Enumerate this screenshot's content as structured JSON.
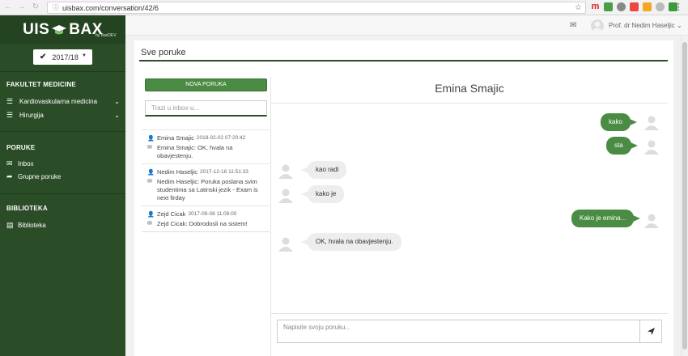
{
  "browser": {
    "url": "uisbax.com/conversation/42/6",
    "ext_m": "m"
  },
  "sidebar": {
    "logo_left": "UIS",
    "logo_right": "BAX",
    "logo_sub": "by BaxDEV",
    "year": "2017/18",
    "sections": [
      {
        "title": "FAKULTET MEDICINE",
        "items": [
          "Kardiovaskularna medicina",
          "Hirurgija"
        ]
      },
      {
        "title": "PORUKE",
        "items": [
          "Inbox",
          "Grupne poruke"
        ]
      },
      {
        "title": "BIBLIOTEKA",
        "items": [
          "Biblioteka"
        ]
      }
    ]
  },
  "header": {
    "user": "Prof. dr Nedim Haseljic"
  },
  "page": {
    "title": "Sve poruke"
  },
  "inbox": {
    "new_button": "NOVA PORUKA",
    "search_placeholder": "Trazi u inbox-u...",
    "conversations": [
      {
        "name": "Emina Smajic",
        "time": "2018-02-02 07:20:42",
        "preview": "Emina Smajic: OK, hvala na obavjestenju."
      },
      {
        "name": "Nedim Haseljic",
        "time": "2017-12-18 11:51:33",
        "preview": "Nedim Haseljic: Poruka poslana svim studentima sa Latinski jezik - Exam is next firday"
      },
      {
        "name": "Zejd Cicak",
        "time": "2017-09-08 11:09:00",
        "preview": "Zejd Cicak: Dobrodosli na sistem!"
      }
    ]
  },
  "chat": {
    "contact": "Emina Smajic",
    "messages": [
      {
        "dir": "out",
        "text": "kako"
      },
      {
        "dir": "out",
        "text": "sta"
      },
      {
        "dir": "in",
        "text": "kao radi"
      },
      {
        "dir": "in",
        "text": "kako je"
      },
      {
        "dir": "out",
        "text": "Kako je emina..."
      },
      {
        "dir": "in",
        "text": "OK, hvala na obavjestenju."
      }
    ],
    "compose_placeholder": "Napisite svoju poruku..."
  },
  "colors": {
    "sidebar": "#2a4d27",
    "accent": "#4a8c43",
    "bubble_in": "#ededed"
  }
}
